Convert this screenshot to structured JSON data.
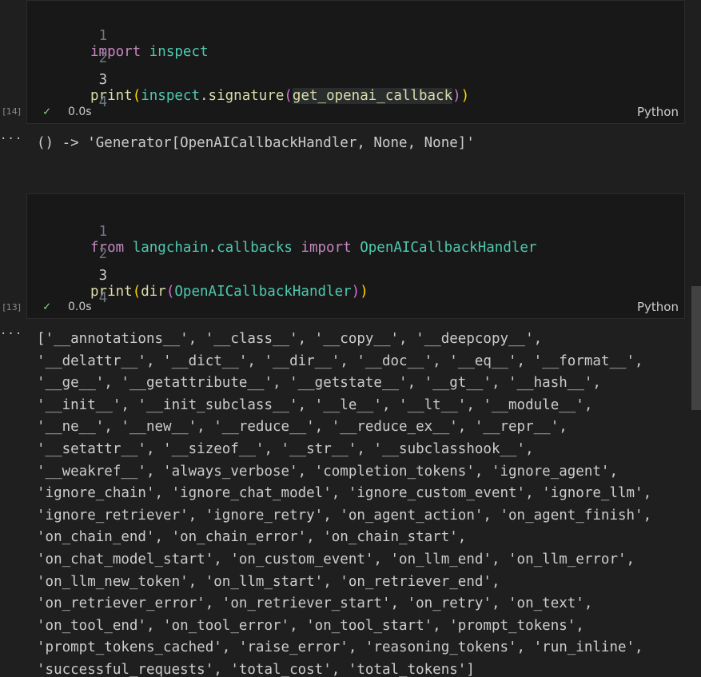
{
  "cells": [
    {
      "exec_count": "[14]",
      "lines": [
        {
          "num": "1"
        },
        {
          "num": "2"
        },
        {
          "num": "3"
        },
        {
          "num": "4"
        }
      ],
      "code": {
        "l1_kw": "import",
        "l1_mod": "inspect",
        "l3_fn": "print",
        "l3_p1o": "(",
        "l3_mod": "inspect",
        "l3_dot": ".",
        "l3_fn2": "signature",
        "l3_p2o": "(",
        "l3_ident": "get_openai_callback",
        "l3_p2c": ")",
        "l3_p1c": ")"
      },
      "status": {
        "check": "✓",
        "time": "0.0s",
        "language": "Python"
      },
      "output_menu": "···",
      "output": "() -> 'Generator[OpenAICallbackHandler, None, None]'"
    },
    {
      "exec_count": "[13]",
      "lines": [
        {
          "num": "1"
        },
        {
          "num": "2"
        },
        {
          "num": "3"
        },
        {
          "num": "4"
        }
      ],
      "code": {
        "l1_kw": "from",
        "l1_mod": "langchain",
        "l1_dot": ".",
        "l1_mod2": "callbacks",
        "l1_kw2": "import",
        "l1_cls": "OpenAICallbackHandler",
        "l3_fn": "print",
        "l3_p1o": "(",
        "l3_fn2": "dir",
        "l3_p2o": "(",
        "l3_cls": "OpenAICallbackHandler",
        "l3_p2c": ")",
        "l3_p1c": ")"
      },
      "status": {
        "check": "✓",
        "time": "0.0s",
        "language": "Python"
      },
      "output_menu": "···",
      "output_lines": [
        "['__annotations__', '__class__', '__copy__', '__deepcopy__',",
        "'__delattr__', '__dict__', '__dir__', '__doc__', '__eq__', '__format__',",
        "'__ge__', '__getattribute__', '__getstate__', '__gt__', '__hash__',",
        "'__init__', '__init_subclass__', '__le__', '__lt__', '__module__',",
        "'__ne__', '__new__', '__reduce__', '__reduce_ex__', '__repr__',",
        "'__setattr__', '__sizeof__', '__str__', '__subclasshook__',",
        "'__weakref__', 'always_verbose', 'completion_tokens', 'ignore_agent',",
        "'ignore_chain', 'ignore_chat_model', 'ignore_custom_event', 'ignore_llm',",
        "'ignore_retriever', 'ignore_retry', 'on_agent_action', 'on_agent_finish',",
        "'on_chain_end', 'on_chain_error', 'on_chain_start',",
        "'on_chat_model_start', 'on_custom_event', 'on_llm_end', 'on_llm_error',",
        "'on_llm_new_token', 'on_llm_start', 'on_retriever_end',",
        "'on_retriever_error', 'on_retriever_start', 'on_retry', 'on_text',",
        "'on_tool_end', 'on_tool_error', 'on_tool_start', 'prompt_tokens',",
        "'prompt_tokens_cached', 'raise_error', 'reasoning_tokens', 'run_inline',",
        "'successful_requests', 'total_cost', 'total_tokens']"
      ]
    }
  ]
}
